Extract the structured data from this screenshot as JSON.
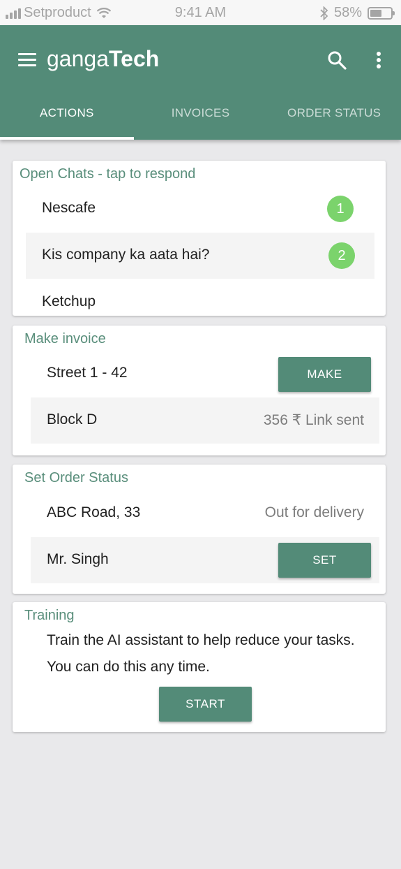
{
  "status_bar": {
    "carrier": "Setproduct",
    "time": "9:41 AM",
    "battery": "58%",
    "battery_level": 0.58
  },
  "app_bar": {
    "title_light": "ganga",
    "title_bold": "Tech",
    "tabs": [
      {
        "label": "ACTIONS",
        "active": true
      },
      {
        "label": "INVOICES",
        "active": false
      },
      {
        "label": "ORDER STATUS",
        "active": false
      }
    ]
  },
  "open_chats": {
    "title": "Open Chats - tap to respond",
    "items": [
      {
        "label": "Nescafe",
        "badge": "1"
      },
      {
        "label": "Kis company ka aata hai?",
        "badge": "2"
      },
      {
        "label": "Ketchup",
        "badge": ""
      }
    ]
  },
  "make_invoice": {
    "title": "Make invoice",
    "rows": [
      {
        "label": "Street 1 - 42",
        "button": "MAKE"
      },
      {
        "label": "Block D",
        "value": "356 ₹ Link sent"
      }
    ]
  },
  "order_status": {
    "title": "Set Order Status",
    "rows": [
      {
        "label": "ABC Road, 33",
        "value": "Out for delivery"
      },
      {
        "label": "Mr. Singh",
        "button": "SET"
      }
    ]
  },
  "training": {
    "title": "Training",
    "text": "Train the AI assistant to help reduce your tasks. You can do this any time.",
    "button": "START"
  },
  "colors": {
    "primary": "#538b78",
    "accent_text": "#598e7b",
    "badge": "#7bd36c"
  },
  "icons": [
    "signal-icon",
    "wifi-icon",
    "bluetooth-icon",
    "battery-icon",
    "menu-icon",
    "search-icon",
    "more-vert-icon"
  ]
}
